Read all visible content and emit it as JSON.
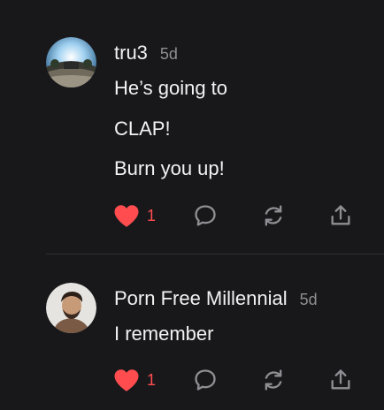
{
  "comments": [
    {
      "author": "tru3",
      "time": "5d",
      "lines": [
        "He’s going to",
        "CLAP!",
        "Burn you up!"
      ],
      "likes": "1",
      "avatar_icon": "fisheye-landscape-photo"
    },
    {
      "author": "Porn Free Millennial",
      "time": "5d",
      "lines": [
        "I remember"
      ],
      "likes": "1",
      "avatar_icon": "man-portrait-photo"
    }
  ],
  "colors": {
    "background": "#18181b",
    "like": "#ff4d4f",
    "icon": "#8e8e93",
    "muted_text": "#8e8e93"
  }
}
